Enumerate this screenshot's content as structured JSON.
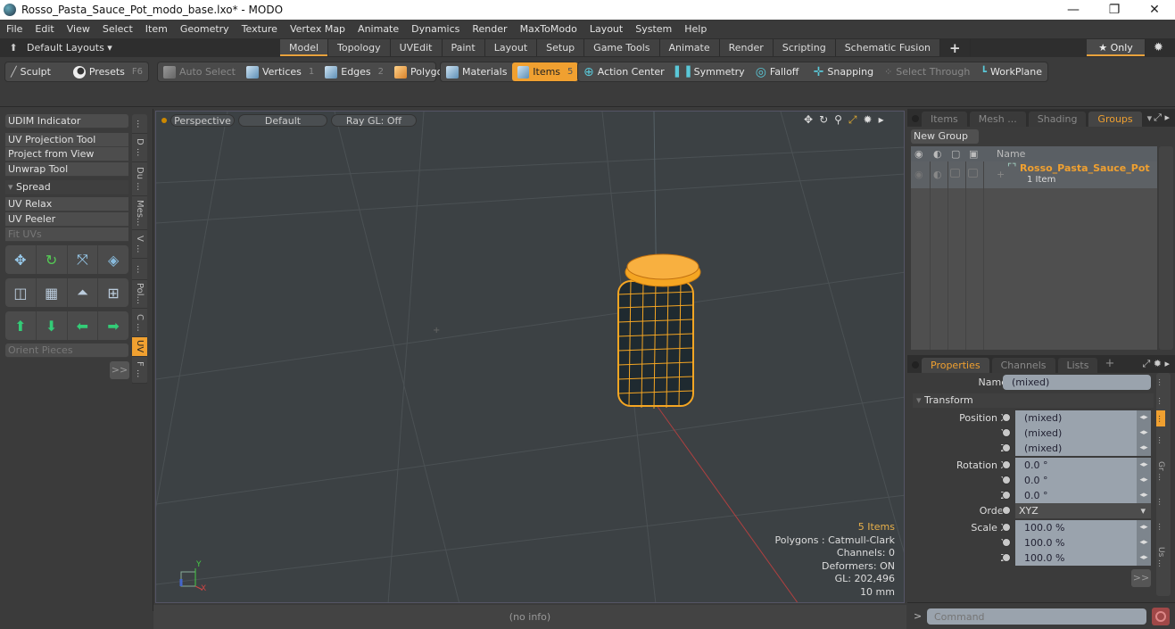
{
  "window": {
    "title": "Rosso_Pasta_Sauce_Pot_modo_base.lxo* - MODO",
    "minimize": "—",
    "restore": "❐",
    "close": "✕"
  },
  "menu": [
    "File",
    "Edit",
    "View",
    "Select",
    "Item",
    "Geometry",
    "Texture",
    "Vertex Map",
    "Animate",
    "Dynamics",
    "Render",
    "MaxToModo",
    "Layout",
    "System",
    "Help"
  ],
  "layoutbar": {
    "layouts_label": "Default Layouts ▾",
    "tabs": [
      {
        "label": "Model",
        "active": true
      },
      {
        "label": "Topology"
      },
      {
        "label": "UVEdit"
      },
      {
        "label": "Paint"
      },
      {
        "label": "Layout"
      },
      {
        "label": "Setup"
      },
      {
        "label": "Game Tools"
      },
      {
        "label": "Animate"
      },
      {
        "label": "Render"
      },
      {
        "label": "Scripting"
      },
      {
        "label": "Schematic Fusion"
      }
    ],
    "add": "+",
    "only_label": "★ Only"
  },
  "toolbar": {
    "sculpt": "Sculpt",
    "presets": "Presets",
    "presets_key": "F6",
    "auto_select": "Auto Select",
    "vertices": "Vertices",
    "vertices_num": "1",
    "edges": "Edges",
    "edges_num": "2",
    "polygons": "Polygons",
    "materials": "Materials",
    "items": "Items",
    "items_num": "5",
    "action_center": "Action Center",
    "symmetry": "Symmetry",
    "falloff": "Falloff",
    "snapping": "Snapping",
    "select_through": "Select Through",
    "workplane": "WorkPlane"
  },
  "leftpanel": {
    "udim": "UDIM Indicator",
    "uv_projection": "UV Projection Tool",
    "project_from_view": "Project from View",
    "unwrap": "Unwrap Tool",
    "spread": "Spread",
    "uv_relax": "UV Relax",
    "uv_peeler": "UV Peeler",
    "fit_uvs": "Fit UVs",
    "orient_pieces": "Orient Pieces",
    "more": ">>",
    "vtabs": [
      "...",
      "D ...",
      "Du ...",
      "Mes...",
      "V ...",
      "...",
      "Pol...",
      "C ...",
      "UV",
      "F ..."
    ]
  },
  "viewport": {
    "view_mode": "Perspective",
    "shading": "Default",
    "raygl": "Ray GL: Off",
    "info": {
      "items": "5 Items",
      "polygons": "Polygons : Catmull-Clark",
      "channels": "Channels: 0",
      "deformers": "Deformers: ON",
      "gl": "GL: 202,496",
      "unit": "10 mm"
    },
    "axis_y": "Y",
    "axis_x": "X"
  },
  "statusbar": {
    "text": "(no info)"
  },
  "groups_panel": {
    "tabs": [
      {
        "label": "Items"
      },
      {
        "label": "Mesh ..."
      },
      {
        "label": "Shading"
      },
      {
        "label": "Groups",
        "active": true
      }
    ],
    "new_group": "New Group",
    "col_name": "Name",
    "group_name": "Rosso_Pasta_Sauce_Pot",
    "group_count": "1 Item"
  },
  "properties_panel": {
    "tabs": [
      {
        "label": "Properties",
        "active": true
      },
      {
        "label": "Channels"
      },
      {
        "label": "Lists"
      }
    ],
    "add": "+",
    "name_label": "Name",
    "name_value": "(mixed)",
    "transform_label": "Transform",
    "rows": [
      {
        "label": "Position X",
        "value": "(mixed)"
      },
      {
        "label": "Y",
        "value": "(mixed)"
      },
      {
        "label": "Z",
        "value": "(mixed)"
      },
      {
        "label": "Rotation X",
        "value": "0.0 °"
      },
      {
        "label": "Y",
        "value": "0.0 °"
      },
      {
        "label": "Z",
        "value": "0.0 °"
      },
      {
        "label": "Order",
        "value": "XYZ"
      },
      {
        "label": "Scale X",
        "value": "100.0 %"
      },
      {
        "label": "Y",
        "value": "100.0 %"
      },
      {
        "label": "Z",
        "value": "100.0 %"
      }
    ],
    "more": ">>",
    "side_tabs": [
      "...",
      "...",
      "...",
      "...",
      "Gr ...",
      "...",
      "...",
      "Us ..."
    ]
  },
  "command": {
    "prompt": ">",
    "placeholder": "Command"
  },
  "colors": {
    "accent": "#f0a030",
    "selection": "#f5a623",
    "viewport_bg": "#3c4144"
  }
}
